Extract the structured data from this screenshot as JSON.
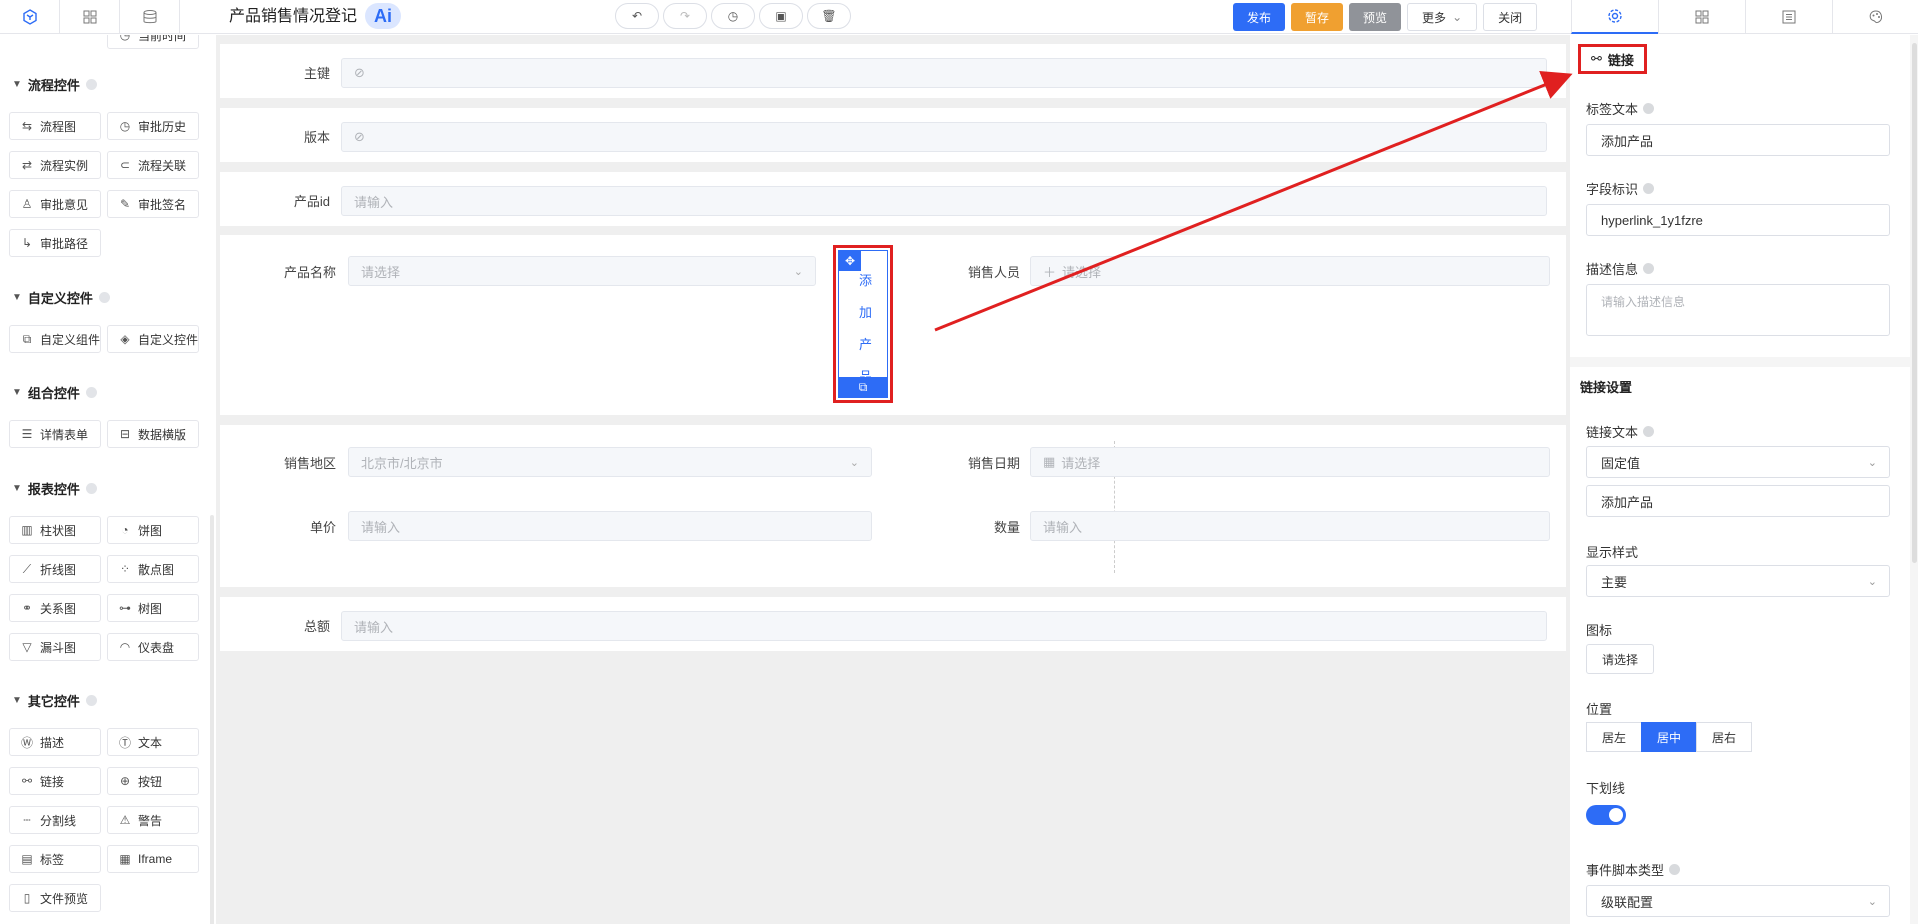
{
  "header": {
    "title": "产品销售情况登记",
    "ai": "Ai",
    "left_tabs": [
      "component-icon",
      "grid-icon",
      "database-icon"
    ],
    "history": [
      "undo-icon",
      "redo-icon",
      "history-icon",
      "clipboard-icon",
      "trash-icon"
    ],
    "actions": {
      "publish": "发布",
      "draft": "暂存",
      "preview": "预览",
      "more": "更多",
      "close": "关闭"
    },
    "right_tabs": [
      "gear-icon",
      "grid-icon",
      "form-icon",
      "palette-icon"
    ]
  },
  "sidebar": {
    "partial_item": "当前时间",
    "sections": [
      {
        "title": "流程控件",
        "items": [
          "流程图",
          "审批历史",
          "流程实例",
          "流程关联",
          "审批意见",
          "审批签名",
          "审批路径"
        ]
      },
      {
        "title": "自定义控件",
        "items": [
          "自定义组件",
          "自定义控件"
        ]
      },
      {
        "title": "组合控件",
        "items": [
          "详情表单",
          "数据横版"
        ]
      },
      {
        "title": "报表控件",
        "items": [
          "柱状图",
          "饼图",
          "折线图",
          "散点图",
          "关系图",
          "树图",
          "漏斗图",
          "仪表盘"
        ]
      },
      {
        "title": "其它控件",
        "items": [
          "描述",
          "文本",
          "链接",
          "按钮",
          "分割线",
          "警告",
          "标签",
          "Iframe",
          "文件预览"
        ]
      }
    ]
  },
  "form": {
    "primary_key": {
      "label": "主键"
    },
    "version": {
      "label": "版本"
    },
    "product_id": {
      "label": "产品id",
      "placeholder": "请输入"
    },
    "product_name": {
      "label": "产品名称",
      "placeholder": "请选择"
    },
    "link_widget": {
      "text": "添加产品"
    },
    "salesperson": {
      "label": "销售人员",
      "placeholder": "请选择"
    },
    "region": {
      "label": "销售地区",
      "value": "北京市/北京市"
    },
    "sale_date": {
      "label": "销售日期",
      "placeholder": "请选择"
    },
    "unit_price": {
      "label": "单价",
      "placeholder": "请输入"
    },
    "quantity": {
      "label": "数量",
      "placeholder": "请输入"
    },
    "total": {
      "label": "总额",
      "placeholder": "请输入"
    }
  },
  "panel": {
    "component_title": "链接",
    "label_text": {
      "label": "标签文本",
      "value": "添加产品"
    },
    "field_id": {
      "label": "字段标识",
      "value": "hyperlink_1y1fzre"
    },
    "description": {
      "label": "描述信息",
      "placeholder": "请输入描述信息"
    },
    "link_settings": "链接设置",
    "link_text": {
      "label": "链接文本",
      "mode": "固定值",
      "value": "添加产品"
    },
    "display_style": {
      "label": "显示样式",
      "value": "主要"
    },
    "icon": {
      "label": "图标",
      "button": "请选择"
    },
    "position": {
      "label": "位置",
      "options": [
        "居左",
        "居中",
        "居右"
      ],
      "selected": "居中"
    },
    "underline": {
      "label": "下划线",
      "on": true
    },
    "event_script": {
      "label": "事件脚本类型",
      "value": "级联配置"
    }
  },
  "colors": {
    "accent": "#2d6cf6",
    "highlight": "#e02020",
    "draft": "#f0a030",
    "preview": "#909399"
  }
}
